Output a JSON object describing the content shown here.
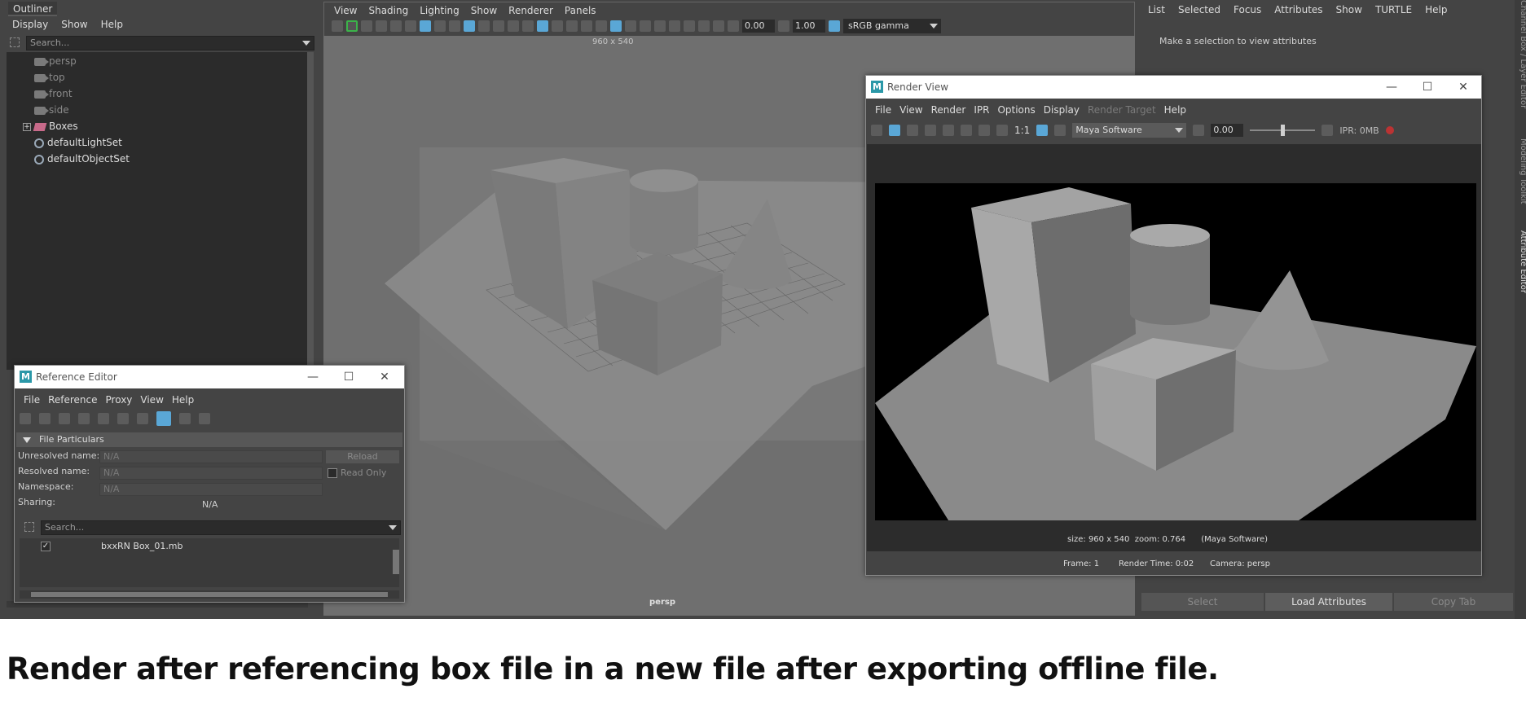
{
  "outliner": {
    "tab": "Outliner",
    "menu": [
      "Display",
      "Show",
      "Help"
    ],
    "search_placeholder": "Search...",
    "items": [
      "persp",
      "top",
      "front",
      "side",
      "Boxes",
      "defaultLightSet",
      "defaultObjectSet"
    ]
  },
  "viewport": {
    "menu": [
      "View",
      "Shading",
      "Lighting",
      "Show",
      "Renderer",
      "Panels"
    ],
    "exposure": "0.00",
    "gamma_value": "1.00",
    "color_space": "sRGB gamma",
    "resolution_gate": "960 x 540",
    "camera_label": "persp"
  },
  "attribute_editor": {
    "menu": [
      "List",
      "Selected",
      "Focus",
      "Attributes",
      "Show",
      "TURTLE",
      "Help"
    ],
    "message": "Make a selection to view attributes",
    "buttons": [
      "Select",
      "Load Attributes",
      "Copy Tab"
    ],
    "side_tabs": [
      "Channel Box / Layer Editor",
      "Modeling Toolkit",
      "Attribute Editor"
    ]
  },
  "render_view": {
    "title": "Render View",
    "menu": [
      "File",
      "View",
      "Render",
      "IPR",
      "Options",
      "Display",
      "Render Target",
      "Help"
    ],
    "ratio": "1:1",
    "renderer": "Maya Software",
    "exposure": "0.00",
    "ipr_memory": "IPR: 0MB",
    "info_line1": "size: 960 x 540  zoom: 0.764      (Maya Software)",
    "info_frame": "Frame: 1",
    "info_time": "Render Time: 0:02",
    "info_camera": "Camera: persp"
  },
  "reference_editor": {
    "title": "Reference Editor",
    "menu": [
      "File",
      "Reference",
      "Proxy",
      "View",
      "Help"
    ],
    "section": "File Particulars",
    "labels": [
      "Unresolved name:",
      "Resolved name:",
      "Namespace:",
      "Sharing:"
    ],
    "values": [
      "N/A",
      "N/A",
      "N/A",
      "N/A"
    ],
    "reload": "Reload",
    "read_only": "Read Only",
    "search_placeholder": "Search...",
    "reference_item": "bxxRN Box_01.mb"
  },
  "caption": "Render after referencing box file in a new file after exporting offline file.",
  "colors": {
    "accent": "#5aa7d6",
    "maya_logo": "#2b98a8",
    "panel_bg": "#444444"
  }
}
